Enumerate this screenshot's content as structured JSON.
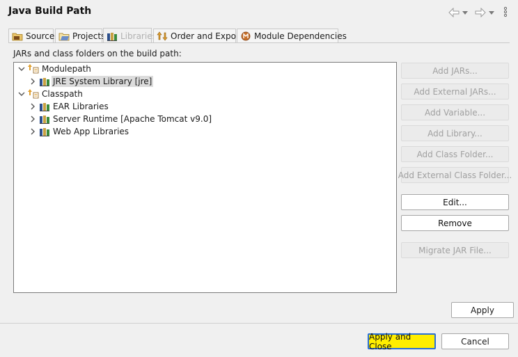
{
  "window": {
    "title": "Java Build Path"
  },
  "nav": {
    "back_icon": "back-arrow-icon",
    "forward_icon": "forward-arrow-icon",
    "menu_icon": "vertical-dots-icon"
  },
  "tabs": [
    {
      "label": "Source",
      "icon": "source-folder-icon"
    },
    {
      "label": "Projects",
      "icon": "projects-folder-icon"
    },
    {
      "label": "Libraries",
      "icon": "library-icon",
      "selected": true
    },
    {
      "label": "Order and Export",
      "icon": "order-export-icon"
    },
    {
      "label": "Module Dependencies",
      "icon": "module-icon"
    }
  ],
  "description": "JARs and class folders on the build path:",
  "tree": {
    "modulepath": {
      "label": "Modulepath",
      "expanded": true,
      "children": [
        {
          "label": "JRE System Library [jre]",
          "selected": true
        }
      ]
    },
    "classpath": {
      "label": "Classpath",
      "expanded": true,
      "children": [
        {
          "label": "EAR Libraries"
        },
        {
          "label": "Server Runtime [Apache Tomcat v9.0]"
        },
        {
          "label": "Web App Libraries"
        }
      ]
    }
  },
  "buttons": {
    "add_jars": "Add JARs...",
    "add_external_jars": "Add External JARs...",
    "add_variable": "Add Variable...",
    "add_library": "Add Library...",
    "add_class_folder": "Add Class Folder...",
    "add_external_class_folder": "Add External Class Folder...",
    "edit": "Edit...",
    "remove": "Remove",
    "migrate_jar": "Migrate JAR File...",
    "apply": "Apply",
    "apply_and_close": "Apply and Close",
    "cancel": "Cancel"
  },
  "colors": {
    "highlight": "#ffee00",
    "focus_border": "#2a6fd6",
    "disabled_text": "#a0a0a0"
  }
}
